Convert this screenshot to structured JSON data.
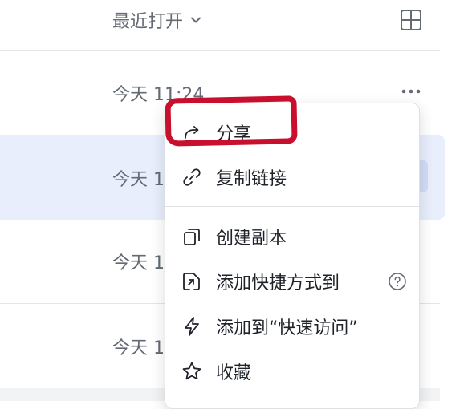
{
  "header": {
    "sort_label": "最近打开"
  },
  "rows": [
    {
      "time": "今天 11:24"
    },
    {
      "time": "今天 1"
    },
    {
      "time": "今天 1"
    },
    {
      "time": "今天 1"
    }
  ],
  "menu": {
    "items": [
      {
        "label": "分享",
        "icon": "share-icon"
      },
      {
        "label": "复制链接",
        "icon": "link-icon"
      },
      {
        "label": "创建副本",
        "icon": "copy-icon"
      },
      {
        "label": "添加快捷方式到",
        "icon": "shortcut-icon"
      },
      {
        "label": "添加到“快速访问”",
        "icon": "lightning-icon"
      },
      {
        "label": "收藏",
        "icon": "star-icon"
      }
    ]
  },
  "colors": {
    "accent": "#c8102e",
    "selected_row": "#e8eefc",
    "text_secondary": "#646a73"
  }
}
